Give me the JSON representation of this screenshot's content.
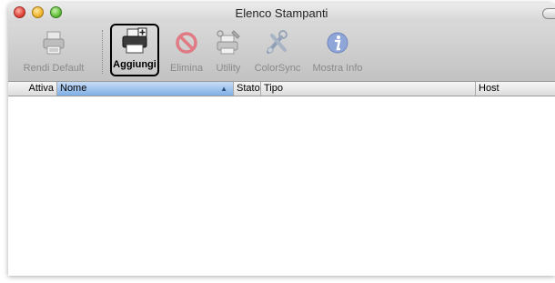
{
  "window": {
    "title": "Elenco Stampanti"
  },
  "toolbar": {
    "items": [
      {
        "label": "Rendi Default",
        "icon": "printer-default-icon",
        "enabled": false
      },
      {
        "label": "Aggiungi",
        "icon": "add-printer-icon",
        "enabled": true,
        "highlighted": true
      },
      {
        "label": "Elimina",
        "icon": "delete-icon",
        "enabled": false
      },
      {
        "label": "Utility",
        "icon": "printer-utility-icon",
        "enabled": false
      },
      {
        "label": "ColorSync",
        "icon": "colorsync-icon",
        "enabled": false
      },
      {
        "label": "Mostra Info",
        "icon": "info-icon",
        "enabled": false
      }
    ]
  },
  "table": {
    "columns": [
      "Attiva",
      "Nome",
      "Stato",
      "Tipo",
      "Host"
    ],
    "sorted_column": "Nome",
    "rows": []
  },
  "colors": {
    "sorted_header": "#7eaee5",
    "toolbar_bg": "#cfcfcf",
    "disabled_text": "#8a8a8a"
  }
}
